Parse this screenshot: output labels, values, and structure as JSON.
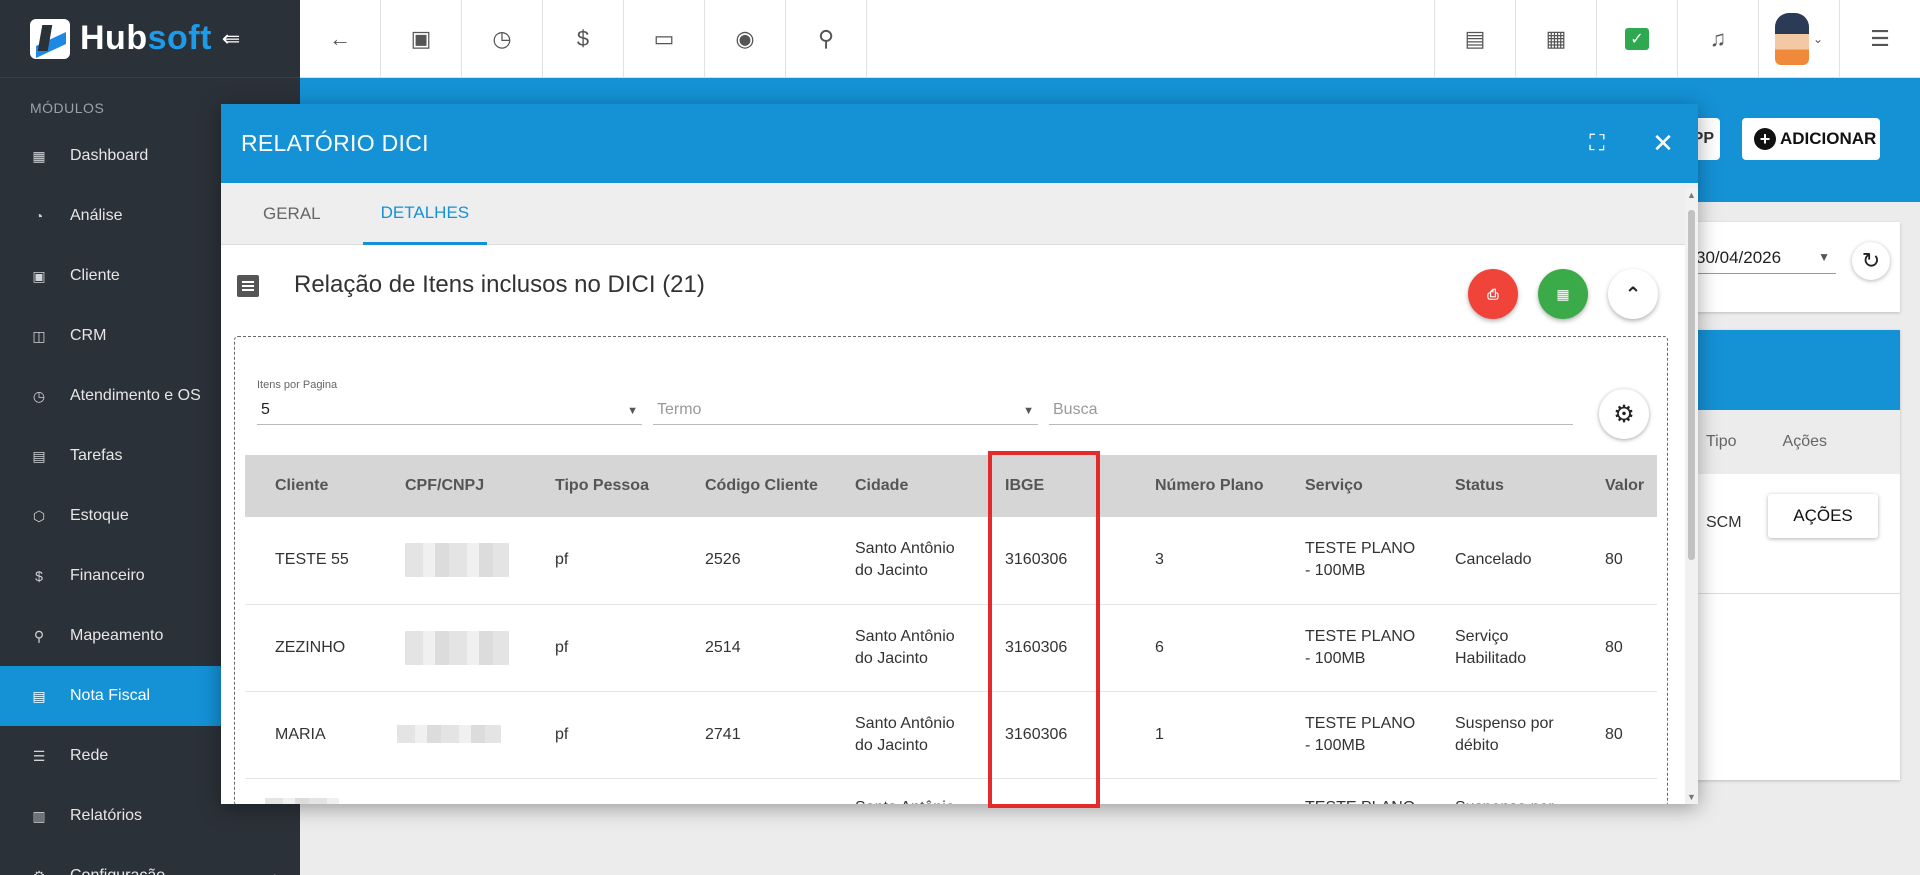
{
  "app": {
    "brand_part1": "Hub",
    "brand_part2": "soft",
    "collapse_glyph": "⇚"
  },
  "sidebar": {
    "section_title": "MÓDULOS",
    "items": [
      {
        "label": "Dashboard",
        "icon": "dashboard-icon"
      },
      {
        "label": "Análise",
        "icon": "pie-chart-icon"
      },
      {
        "label": "Cliente",
        "icon": "contact-card-icon"
      },
      {
        "label": "CRM",
        "icon": "crm-board-icon"
      },
      {
        "label": "Atendimento e OS",
        "icon": "calendar-clock-icon"
      },
      {
        "label": "Tarefas",
        "icon": "task-calendar-icon"
      },
      {
        "label": "Estoque",
        "icon": "box-icon"
      },
      {
        "label": "Financeiro",
        "icon": "money-icon"
      },
      {
        "label": "Mapeamento",
        "icon": "map-pin-icon"
      },
      {
        "label": "Nota Fiscal",
        "icon": "invoice-icon",
        "active": true
      },
      {
        "label": "Rede",
        "icon": "server-icon"
      },
      {
        "label": "Relatórios",
        "icon": "report-icon"
      },
      {
        "label": "Configuração",
        "icon": "settings-icon"
      }
    ]
  },
  "topbar": {
    "left_icons": [
      "back-arrow-icon",
      "client-card-icon",
      "calendar-clock-icon",
      "dollar-icon",
      "terminal-icon",
      "eye-icon",
      "search-icon"
    ],
    "right_icons": [
      "pdf-file-icon",
      "building-icon",
      "check-icon",
      "bell-icon",
      "avatar",
      "list-menu-icon"
    ]
  },
  "background_page": {
    "app_button_fragment": "PP",
    "add_button_label": "ADICIONAR",
    "date_value": "30/04/2026",
    "col_tipo": "Tipo",
    "col_acoes": "Ações",
    "row_tipo": "SCM",
    "row_acoes_button": "AÇÕES"
  },
  "modal": {
    "title": "RELATÓRIO DICI",
    "tabs": [
      {
        "label": "GERAL",
        "active": false
      },
      {
        "label": "DETALHES",
        "active": true
      }
    ],
    "section_title": "Relação de Itens inclusos no DICI (21)",
    "filters": {
      "per_page_label": "Itens por Pagina",
      "per_page_value": "5",
      "termo_placeholder": "Termo",
      "busca_placeholder": "Busca"
    },
    "table": {
      "headers": [
        "Cliente",
        "CPF/CNPJ",
        "Tipo Pessoa",
        "Código Cliente",
        "Cidade",
        "IBGE",
        "Número Plano",
        "Serviço",
        "Status",
        "Valor"
      ],
      "rows": [
        {
          "cliente": "TESTE 55",
          "tipo": "pf",
          "codigo": "2526",
          "cidade": "Santo Antônio do Jacinto",
          "ibge": "3160306",
          "plano": "3",
          "servico": "TESTE PLANO - 100MB",
          "status": "Cancelado",
          "valor": "80"
        },
        {
          "cliente": "ZEZINHO",
          "tipo": "pf",
          "codigo": "2514",
          "cidade": "Santo Antônio do Jacinto",
          "ibge": "3160306",
          "plano": "6",
          "servico": "TESTE PLANO - 100MB",
          "status": "Serviço Habilitado",
          "valor": "80"
        },
        {
          "cliente": "MARIA",
          "tipo": "pf",
          "codigo": "2741",
          "cidade": "Santo Antônio do Jacinto",
          "ibge": "3160306",
          "plano": "1",
          "servico": "TESTE PLANO - 100MB",
          "status": "Suspenso por débito",
          "valor": "80"
        },
        {
          "cliente": "",
          "tipo": "",
          "codigo": "",
          "cidade": "Santo Antônio do",
          "ibge": "",
          "plano": "",
          "servico": "TESTE PLANO -",
          "status": "Suspenso por",
          "valor": ""
        }
      ]
    }
  },
  "colors": {
    "primary": "#1591d6",
    "sidebar_bg": "#2b3138",
    "highlight": "#e32b2b",
    "pdf_red": "#f0433a",
    "excel_green": "#3bab49"
  }
}
